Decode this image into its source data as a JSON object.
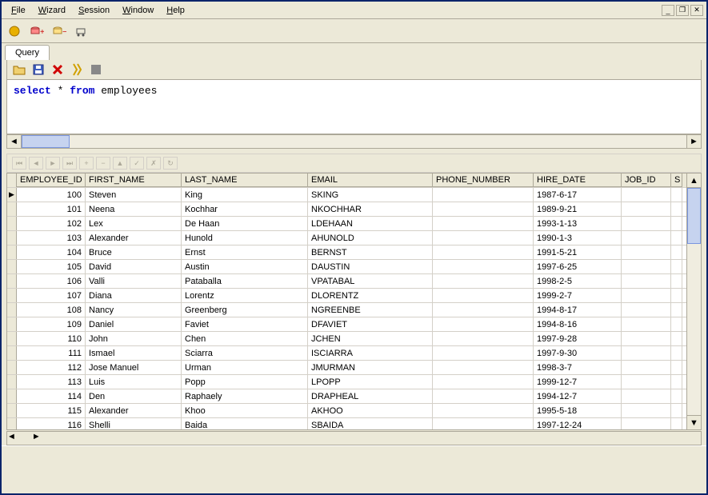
{
  "menu": {
    "items": [
      "File",
      "Wizard",
      "Session",
      "Window",
      "Help"
    ]
  },
  "tabs": {
    "active": "Query"
  },
  "sql": {
    "kw1": "select",
    "star": " * ",
    "kw2": "from",
    "tbl": " employees"
  },
  "columns": [
    "EMPLOYEE_ID",
    "FIRST_NAME",
    "LAST_NAME",
    "EMAIL",
    "PHONE_NUMBER",
    "HIRE_DATE",
    "JOB_ID",
    "S"
  ],
  "rows": [
    {
      "id": "100",
      "fn": "Steven",
      "ln": "King",
      "em": "SKING",
      "ph": "",
      "hd": "1987-6-17",
      "ji": ""
    },
    {
      "id": "101",
      "fn": "Neena",
      "ln": "Kochhar",
      "em": "NKOCHHAR",
      "ph": "",
      "hd": "1989-9-21",
      "ji": ""
    },
    {
      "id": "102",
      "fn": "Lex",
      "ln": "De Haan",
      "em": "LDEHAAN",
      "ph": "",
      "hd": "1993-1-13",
      "ji": ""
    },
    {
      "id": "103",
      "fn": "Alexander",
      "ln": "Hunold",
      "em": "AHUNOLD",
      "ph": "",
      "hd": "1990-1-3",
      "ji": ""
    },
    {
      "id": "104",
      "fn": "Bruce",
      "ln": "Ernst",
      "em": "BERNST",
      "ph": "",
      "hd": "1991-5-21",
      "ji": ""
    },
    {
      "id": "105",
      "fn": "David",
      "ln": "Austin",
      "em": "DAUSTIN",
      "ph": "",
      "hd": "1997-6-25",
      "ji": ""
    },
    {
      "id": "106",
      "fn": "Valli",
      "ln": "Pataballa",
      "em": "VPATABAL",
      "ph": "",
      "hd": "1998-2-5",
      "ji": ""
    },
    {
      "id": "107",
      "fn": "Diana",
      "ln": "Lorentz",
      "em": "DLORENTZ",
      "ph": "",
      "hd": "1999-2-7",
      "ji": ""
    },
    {
      "id": "108",
      "fn": "Nancy",
      "ln": "Greenberg",
      "em": "NGREENBE",
      "ph": "",
      "hd": "1994-8-17",
      "ji": ""
    },
    {
      "id": "109",
      "fn": "Daniel",
      "ln": "Faviet",
      "em": "DFAVIET",
      "ph": "",
      "hd": "1994-8-16",
      "ji": ""
    },
    {
      "id": "110",
      "fn": "John",
      "ln": "Chen",
      "em": "JCHEN",
      "ph": "",
      "hd": "1997-9-28",
      "ji": ""
    },
    {
      "id": "111",
      "fn": "Ismael",
      "ln": "Sciarra",
      "em": "ISCIARRA",
      "ph": "",
      "hd": "1997-9-30",
      "ji": ""
    },
    {
      "id": "112",
      "fn": "Jose Manuel",
      "ln": "Urman",
      "em": "JMURMAN",
      "ph": "",
      "hd": "1998-3-7",
      "ji": ""
    },
    {
      "id": "113",
      "fn": "Luis",
      "ln": "Popp",
      "em": "LPOPP",
      "ph": "",
      "hd": "1999-12-7",
      "ji": ""
    },
    {
      "id": "114",
      "fn": "Den",
      "ln": "Raphaely",
      "em": "DRAPHEAL",
      "ph": "",
      "hd": "1994-12-7",
      "ji": ""
    },
    {
      "id": "115",
      "fn": "Alexander",
      "ln": "Khoo",
      "em": "AKHOO",
      "ph": "",
      "hd": "1995-5-18",
      "ji": ""
    },
    {
      "id": "116",
      "fn": "Shelli",
      "ln": "Baida",
      "em": "SBAIDA",
      "ph": "",
      "hd": "1997-12-24",
      "ji": ""
    }
  ]
}
